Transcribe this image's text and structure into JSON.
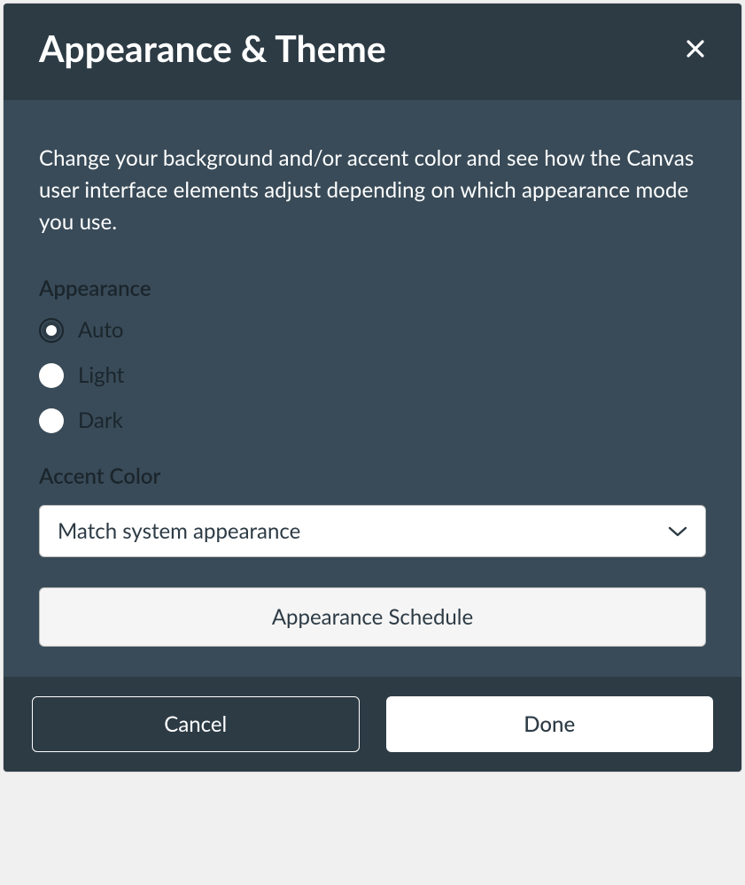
{
  "header": {
    "title": "Appearance & Theme"
  },
  "body": {
    "description": "Change your background and/or accent color and see how the Canvas user interface elements adjust depending on which appearance mode you use.",
    "appearance": {
      "label": "Appearance",
      "options": [
        {
          "label": "Auto",
          "selected": true
        },
        {
          "label": "Light",
          "selected": false
        },
        {
          "label": "Dark",
          "selected": false
        }
      ]
    },
    "accent": {
      "label": "Accent Color",
      "selected": "Match system appearance"
    },
    "schedule_button": "Appearance Schedule"
  },
  "footer": {
    "cancel": "Cancel",
    "done": "Done"
  }
}
